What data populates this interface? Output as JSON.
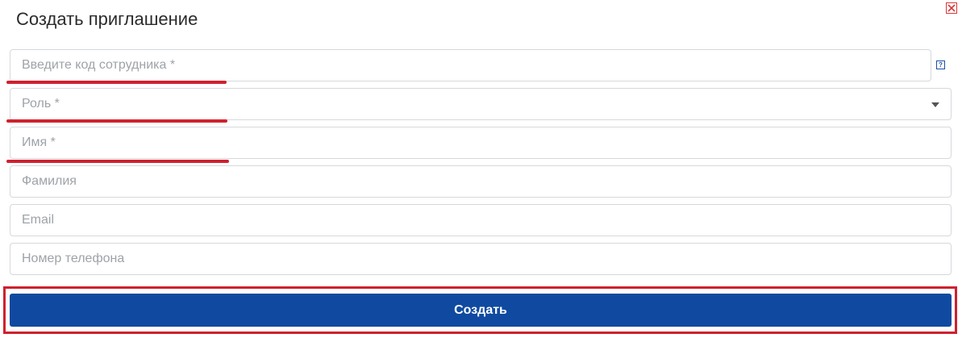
{
  "dialog": {
    "title": "Создать приглашение",
    "close_icon": "close-icon"
  },
  "form": {
    "employee_code": {
      "value": "",
      "placeholder": "Введите код сотрудника *"
    },
    "help_icon": "question-icon",
    "role": {
      "selected": "Роль *",
      "icon": "chevron-down-icon"
    },
    "first_name": {
      "value": "",
      "placeholder": "Имя *"
    },
    "last_name": {
      "value": "",
      "placeholder": "Фамилия"
    },
    "email": {
      "value": "",
      "placeholder": "Email"
    },
    "phone": {
      "value": "",
      "placeholder": "Номер телефона"
    },
    "submit_label": "Создать"
  },
  "annotations": {
    "color": "#d0202e"
  },
  "colors": {
    "primary": "#0f4aa0",
    "border": "#d5d8dc",
    "placeholder": "#9ea3a8"
  }
}
